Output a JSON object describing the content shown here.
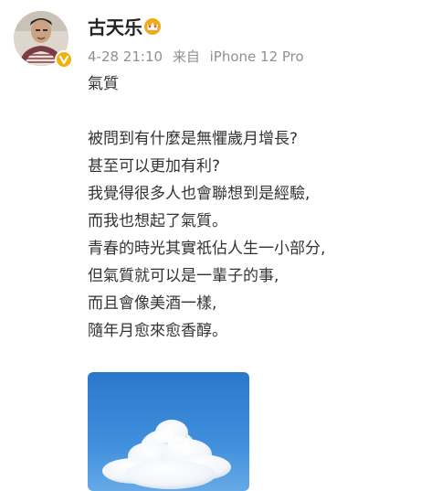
{
  "post": {
    "username": "古天乐",
    "date": "4-28 21:10",
    "source_prefix": "来自",
    "device": "iPhone 12 Pro",
    "lines": [
      "氣質",
      "",
      "被問到有什麼是無懼歲月增長?",
      "甚至可以更加有利?",
      "我覺得很多人也會聯想到是經驗,",
      "而我也想起了氣質。",
      "青春的時光其實祇佔人生一小部分,",
      "但氣質就可以是一輩子的事,",
      "而且會像美酒一樣,",
      "隨年月愈來愈香醇。"
    ]
  },
  "icons": {
    "verified": "verified-v-icon",
    "member_badge": "crown-badge-icon"
  },
  "colors": {
    "verified_badge": "#f1b10a",
    "meta_text": "#909090",
    "sky": "#2e7fd0"
  }
}
